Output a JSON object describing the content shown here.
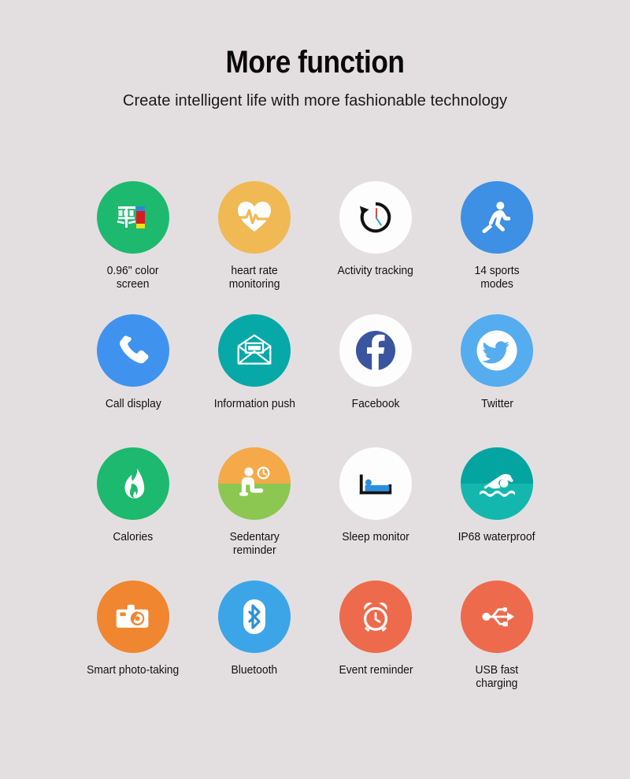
{
  "header": {
    "title": "More function",
    "subtitle": "Create intelligent life with more fashionable technology"
  },
  "colors": {
    "background": "#e3dfe0",
    "green": "#1db96e",
    "amber": "#f0b954",
    "white": "#fdfdfd",
    "blue": "#3d90e3",
    "call_blue": "#3f93ee",
    "teal": "#06a8a8",
    "facebook_blue": "#3a559f",
    "twitter_blue": "#55acee",
    "flame_green": "#1db96e",
    "sedentary_top": "#f5a949",
    "sedentary_bottom": "#8cc751",
    "water_teal_top": "#04a5a0",
    "water_teal_bottom": "#14b7ad",
    "orange": "#f0862f",
    "bluetooth_blue": "#3ba5e8",
    "coral": "#ed6a4c",
    "text": "#121212"
  },
  "features": [
    {
      "id": "color-screen",
      "label": "0.96\" color\nscreen",
      "icon": "color-screen-icon",
      "circle_color": "#1db96e"
    },
    {
      "id": "heart-rate",
      "label": "heart rate\nmonitoring",
      "icon": "heart-pulse-icon",
      "circle_color": "#f0b954"
    },
    {
      "id": "activity-tracking",
      "label": "Activity tracking",
      "icon": "clock-history-icon",
      "circle_color": "#fdfdfd"
    },
    {
      "id": "sports-modes",
      "label": "14 sports\nmodes",
      "icon": "running-person-icon",
      "circle_color": "#3d90e3"
    },
    {
      "id": "call-display",
      "label": "Call display",
      "icon": "phone-icon",
      "circle_color": "#3f93ee"
    },
    {
      "id": "information-push",
      "label": "Information push",
      "icon": "envelope-icon",
      "circle_color": "#06a8a8"
    },
    {
      "id": "facebook",
      "label": "Facebook",
      "icon": "facebook-icon",
      "circle_color": "#fdfdfd"
    },
    {
      "id": "twitter",
      "label": "Twitter",
      "icon": "twitter-bird-icon",
      "circle_color": "#55acee"
    },
    {
      "id": "calories",
      "label": "Calories",
      "icon": "flame-icon",
      "circle_color": "#1db96e"
    },
    {
      "id": "sedentary-reminder",
      "label": "Sedentary\nreminder",
      "icon": "sitting-person-clock-icon",
      "circle_color": "#f5a949"
    },
    {
      "id": "sleep-monitor",
      "label": "Sleep monitor",
      "icon": "bed-icon",
      "circle_color": "#fdfdfd"
    },
    {
      "id": "ip68-waterproof",
      "label": "IP68 waterproof",
      "icon": "swimmer-icon",
      "circle_color": "#06a8a8"
    },
    {
      "id": "smart-photo",
      "label": "Smart photo-taking",
      "icon": "camera-icon",
      "circle_color": "#f0862f"
    },
    {
      "id": "bluetooth",
      "label": "Bluetooth",
      "icon": "bluetooth-icon",
      "circle_color": "#3ba5e8"
    },
    {
      "id": "event-reminder",
      "label": "Event reminder",
      "icon": "alarm-clock-icon",
      "circle_color": "#ed6a4c"
    },
    {
      "id": "usb-fast-charging",
      "label": "USB fast\ncharging",
      "icon": "usb-icon",
      "circle_color": "#ed6a4c"
    }
  ]
}
